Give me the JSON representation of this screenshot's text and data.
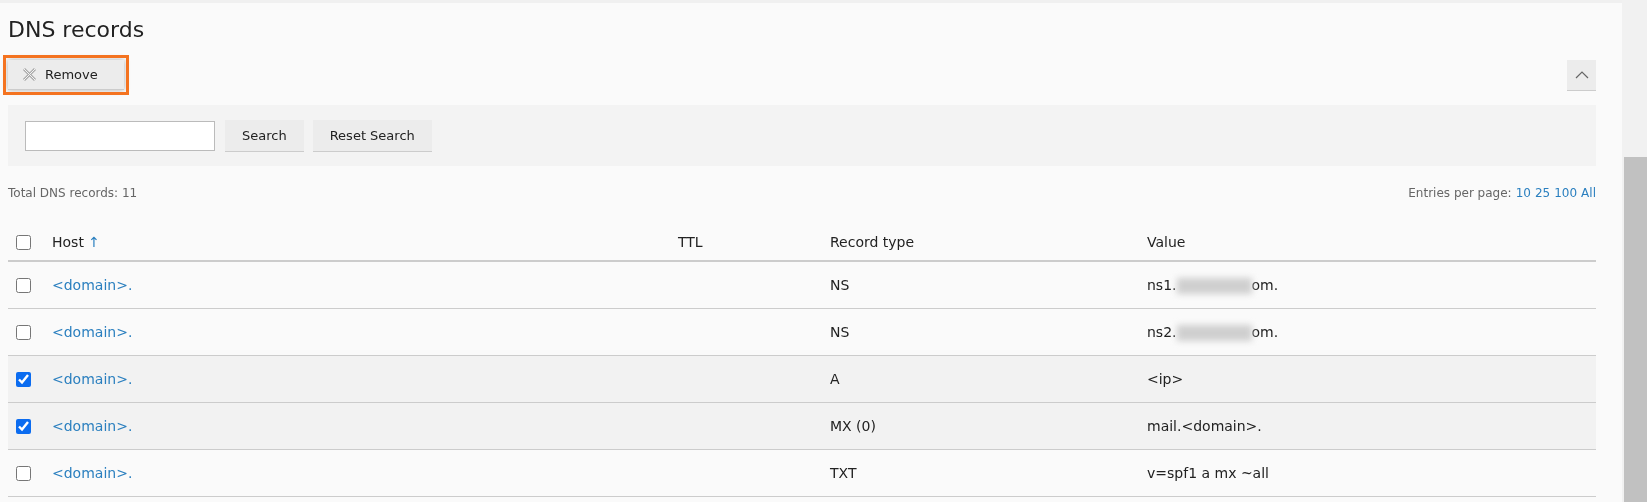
{
  "title": "DNS records",
  "toolbar": {
    "remove_button": {
      "label": "Remove",
      "highlighted": true
    },
    "collapse_button": {
      "expanded": true
    }
  },
  "search": {
    "buttons": [
      {
        "label": "Search"
      },
      {
        "label": "Reset Search"
      }
    ]
  },
  "summary": {
    "total": "Total DNS records: 11",
    "entries_label": "Entries per page:",
    "entries_options": [
      {
        "label": "10"
      },
      {
        "label": "25"
      },
      {
        "label": "100"
      },
      {
        "label": "All"
      }
    ]
  },
  "table": {
    "select_all": {
      "checked": false
    },
    "columns": [
      {
        "label": "Host",
        "sort": "↑"
      },
      {
        "label": "TTL"
      },
      {
        "label": "Record type"
      },
      {
        "label": "Value"
      }
    ],
    "rows": [
      {
        "checked": false,
        "host": "<domain>.",
        "type": "NS",
        "value": "ns1.",
        "redacted": true,
        "value_end": "om."
      },
      {
        "checked": false,
        "host": "<domain>.",
        "type": "NS",
        "value": "ns2.",
        "redacted": true,
        "value_end": "om."
      },
      {
        "checked": true,
        "host": "<domain>.",
        "type": "A",
        "value": "<ip>",
        "redacted": false
      },
      {
        "checked": true,
        "host": "<domain>.",
        "type": "MX (0)",
        "value": "mail.<domain>.",
        "redacted": false
      },
      {
        "checked": false,
        "host": "<domain>.",
        "type": "TXT",
        "value": "v=spf1 a mx ~all",
        "redacted": false
      }
    ]
  }
}
